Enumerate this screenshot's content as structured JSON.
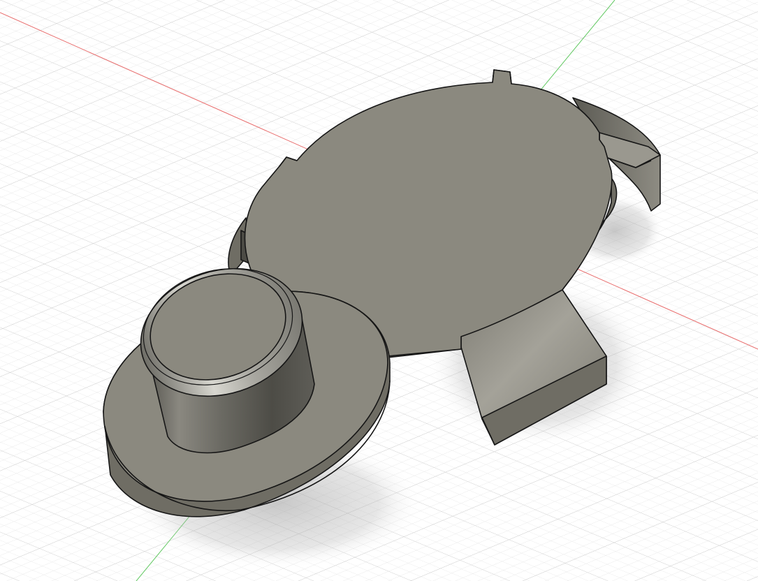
{
  "viewport": {
    "kind": "3d-cad-canvas",
    "background": "#ffffff",
    "grid": {
      "visible": true,
      "minor_color": "#e4e4e4",
      "major_color": "#cdcdcd"
    },
    "axes": {
      "x_color": "#e86a6a",
      "y_color": "#63c963"
    }
  },
  "model": {
    "body_color": "#8c8a80",
    "top_face_color": "#8b897f",
    "side_color": "#6f6d64",
    "edge_color": "#161616",
    "parts": [
      "main-disc",
      "side-clip",
      "bottom-tab",
      "flange-base",
      "cylindrical-boss"
    ]
  }
}
